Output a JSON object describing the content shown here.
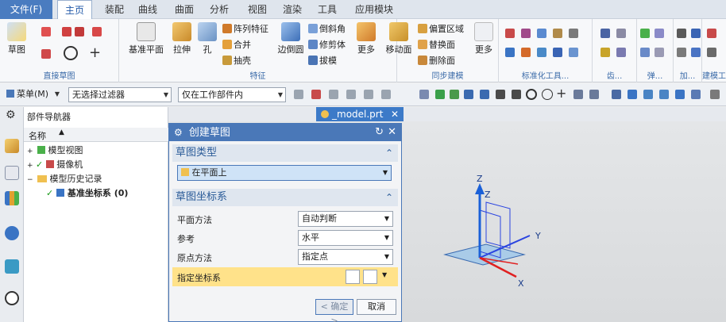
{
  "menubar": {
    "file": "文件(F)",
    "items": [
      "主页",
      "装配",
      "曲线",
      "曲面",
      "分析",
      "视图",
      "渲染",
      "工具",
      "应用模块"
    ]
  },
  "ribbon": {
    "sketch": "草图",
    "direct_sketch_label": "直接草图",
    "datum_plane": "基准平面",
    "extrude": "拉伸",
    "hole": "孔",
    "pattern_feature": "阵列特征",
    "unite": "合并",
    "shell": "抽壳",
    "edge_blend": "边倒圆",
    "chamfer": "倒斜角",
    "trim_body": "修剪体",
    "draft": "拔模",
    "more": "更多",
    "features_label": "特征",
    "move_face": "移动面",
    "offset_region": "偏置区域",
    "replace_face": "替换面",
    "delete_face": "删除面",
    "more2": "更多",
    "sync_label": "同步建模",
    "std_tools_label": "标准化工具...",
    "gear_label": "齿...",
    "spring_label": "弹...",
    "machining_label": "加...",
    "modeling_tools_label": "建模工具..."
  },
  "toolbar2": {
    "menu": "菜单(M)",
    "filter": "无选择过滤器",
    "scope": "仅在工作部件内"
  },
  "navigator": {
    "title": "部件导航器",
    "column": "名称",
    "rows": [
      {
        "label": "模型视图",
        "check": ""
      },
      {
        "label": "摄像机",
        "check": "✓"
      },
      {
        "label": "模型历史记录",
        "check": ""
      },
      {
        "label": "基准坐标系 (0)",
        "check": "✓"
      }
    ]
  },
  "tab": {
    "label": "_model.prt"
  },
  "dialog": {
    "title": "创建草图",
    "section1": "草图类型",
    "sketch_type": "在平面上",
    "section2": "草图坐标系",
    "plane_method_label": "平面方法",
    "plane_method_value": "自动判断",
    "reference_label": "参考",
    "reference_value": "水平",
    "origin_method_label": "原点方法",
    "origin_method_value": "指定点",
    "specify_csys": "指定坐标系",
    "ok": "< 确定 >",
    "cancel": "取消"
  },
  "axes": {
    "x": "X",
    "y": "Y",
    "z": "Z"
  },
  "colors": {
    "accent": "#4a78b8",
    "active_row": "#ffe28a",
    "axis_x": "#e02020",
    "axis_y": "#2a44e0",
    "axis_z": "#1a60d8"
  }
}
